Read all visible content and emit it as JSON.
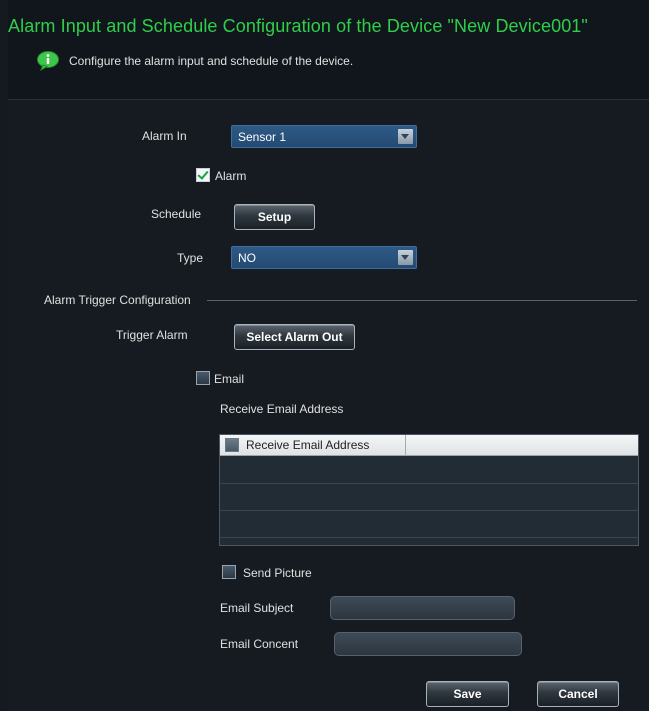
{
  "header": {
    "title": "Alarm Input and Schedule Configuration of the Device \"New Device001\"",
    "subtitle": "Configure the alarm input and schedule of the device."
  },
  "form": {
    "alarm_in_label": "Alarm In",
    "alarm_in_value": "Sensor 1",
    "alarm_label": "Alarm",
    "alarm_checked": true,
    "schedule_label": "Schedule",
    "setup_button": "Setup",
    "type_label": "Type",
    "type_value": "NO"
  },
  "trigger": {
    "section_title": "Alarm Trigger Configuration",
    "trigger_alarm_label": "Trigger Alarm",
    "select_alarm_out_button": "Select Alarm Out",
    "email_label": "Email",
    "email_checked": false,
    "receive_email_heading": "Receive Email Address",
    "table_header": "Receive Email Address",
    "send_picture_label": "Send Picture",
    "send_picture_checked": false,
    "email_subject_label": "Email Subject",
    "email_subject_value": "",
    "email_content_label": "Email Concent",
    "email_content_value": ""
  },
  "footer": {
    "save_button": "Save",
    "cancel_button": "Cancel"
  },
  "colors": {
    "title": "#2fcf4a",
    "background": "#151b21",
    "combo": "#2e5a86"
  },
  "icons": {
    "info": "info-bubble-icon",
    "dropdown": "chevron-down-icon",
    "check": "checkmark-icon"
  }
}
